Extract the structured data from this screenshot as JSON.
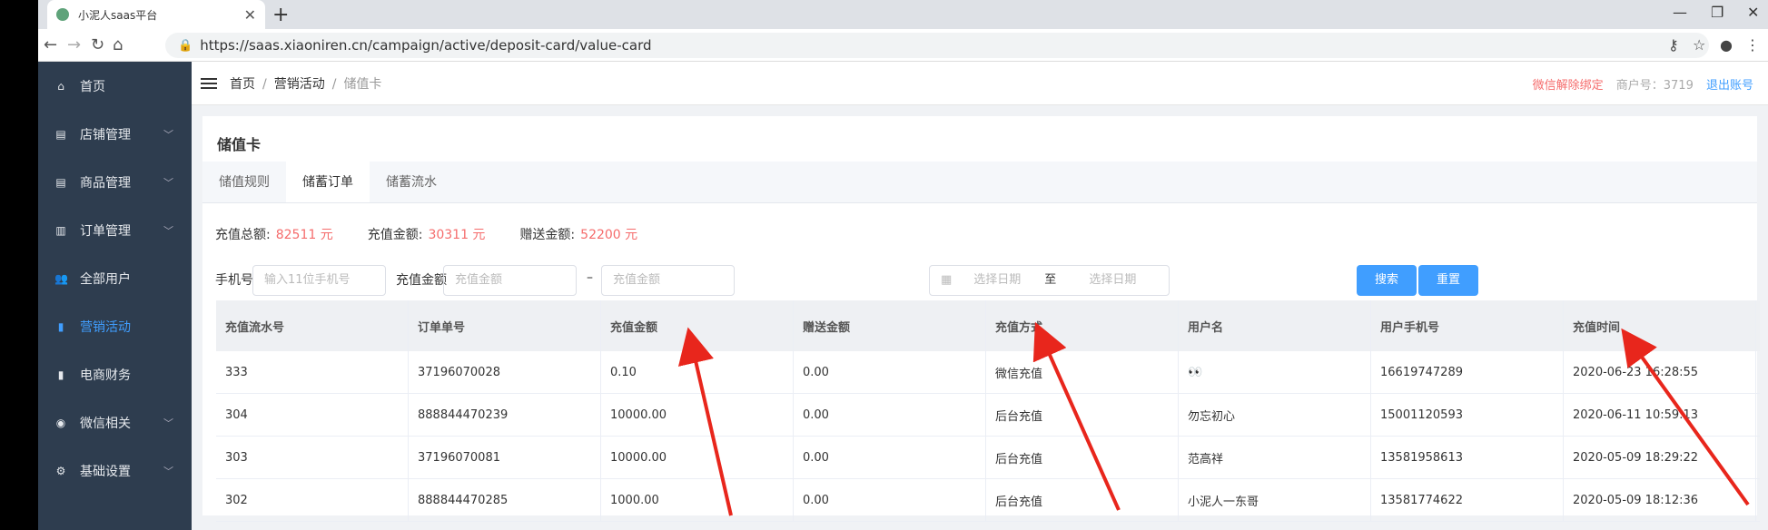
{
  "browser": {
    "tab_title": "小泥人saas平台",
    "url": "https://saas.xiaoniren.cn/campaign/active/deposit-card/value-card"
  },
  "sidebar": {
    "items": [
      {
        "label": "首页",
        "icon": "home-icon"
      },
      {
        "label": "店铺管理",
        "icon": "store-icon"
      },
      {
        "label": "商品管理",
        "icon": "goods-icon"
      },
      {
        "label": "订单管理",
        "icon": "order-icon"
      },
      {
        "label": "全部用户",
        "icon": "users-icon"
      },
      {
        "label": "营销活动",
        "icon": "chart-icon"
      },
      {
        "label": "电商财务",
        "icon": "finance-icon"
      },
      {
        "label": "微信相关",
        "icon": "wechat-icon"
      },
      {
        "label": "基础设置",
        "icon": "gear-icon"
      }
    ],
    "active": "营销活动"
  },
  "header": {
    "breadcrumb": [
      "首页",
      "营销活动",
      "储值卡"
    ],
    "unbind": "微信解除绑定",
    "merchant": "商户号：3719",
    "logout": "退出账号"
  },
  "page": {
    "title": "储值卡",
    "tabs": [
      "储值规则",
      "储蓄订单",
      "储蓄流水"
    ],
    "active_tab": "储蓄订单"
  },
  "stats": {
    "total_label": "充值总额:",
    "total_value": "82511 元",
    "amount_label": "充值金额:",
    "amount_value": "30311 元",
    "bonus_label": "赠送金额:",
    "bonus_value": "52200 元"
  },
  "filters": {
    "phone_label": "手机号",
    "phone_placeholder": "输入11位手机号",
    "amount_label": "充值金额",
    "amount_placeholder": "充值金额",
    "dash": "–",
    "date_placeholder": "选择日期",
    "date_to": "至",
    "search": "搜索",
    "reset": "重置"
  },
  "table": {
    "headers": [
      "充值流水号",
      "订单单号",
      "充值金额",
      "赠送金额",
      "充值方式",
      "用户名",
      "用户手机号",
      "充值时间"
    ],
    "rows": [
      [
        "333",
        "37196070028",
        "0.10",
        "0.00",
        "微信充值",
        "👀",
        "16619747289",
        "2020-06-23 16:28:55"
      ],
      [
        "304",
        "888844470239",
        "10000.00",
        "0.00",
        "后台充值",
        "勿忘初心",
        "15001120593",
        "2020-06-11 10:59:13"
      ],
      [
        "303",
        "37196070081",
        "10000.00",
        "0.00",
        "后台充值",
        "范高祥",
        "13581958613",
        "2020-05-09 18:29:22"
      ],
      [
        "302",
        "888844470285",
        "1000.00",
        "0.00",
        "后台充值",
        "小泥人一东哥",
        "13581774622",
        "2020-05-09 18:12:36"
      ]
    ]
  },
  "colors": {
    "accent": "#409eff",
    "sidebar": "#2e3d4f",
    "highlight": "#f56c6c",
    "arrow": "#e8261c"
  }
}
